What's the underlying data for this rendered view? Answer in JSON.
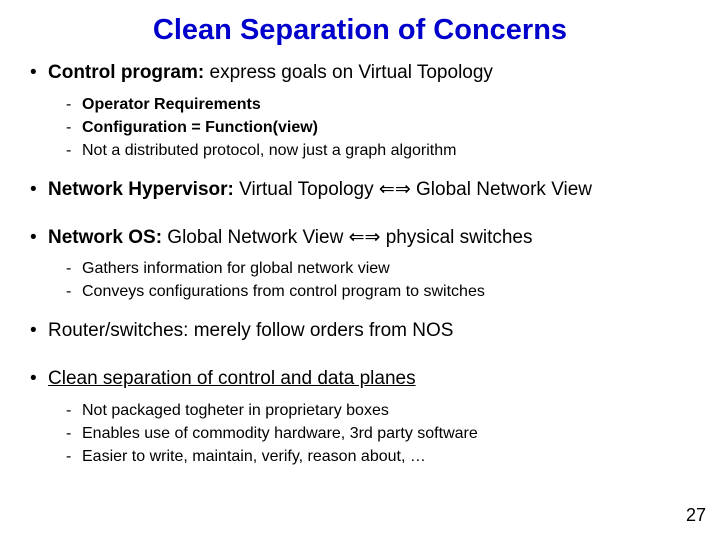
{
  "title": "Clean Separation of Concerns",
  "bullets": [
    {
      "level": 1,
      "bold_prefix": "Control program:",
      "rest": " express goals on Virtual Topology"
    },
    {
      "level": 2,
      "bold": true,
      "text": "Operator Requirements"
    },
    {
      "level": 2,
      "bold": true,
      "text": "Configuration = Function(view)"
    },
    {
      "level": 2,
      "bold": false,
      "text": "Not a distributed protocol, now just a graph algorithm"
    },
    {
      "level": 1,
      "bold_prefix": "Network Hypervisor:",
      "rest_before": " Virtual Topology ",
      "arrows": "⇔",
      "rest_after": " Global Network View"
    },
    {
      "level": 1,
      "bold_prefix": "Network OS:",
      "rest_before": " Global Network View ",
      "arrows": "⇔",
      "rest_after": " physical switches"
    },
    {
      "level": 2,
      "bold": false,
      "text": "Gathers information for global network view"
    },
    {
      "level": 2,
      "bold": false,
      "text": "Conveys configurations from control program to switches"
    },
    {
      "level": 1,
      "plain": "Router/switches: merely follow orders from NOS"
    },
    {
      "level": 1,
      "underline_text": "Clean separation of control and data planes"
    },
    {
      "level": 2,
      "bold": false,
      "text": "Not packaged togheter in proprietary boxes"
    },
    {
      "level": 2,
      "bold": false,
      "text": "Enables use of commodity hardware, 3rd party software"
    },
    {
      "level": 2,
      "bold": false,
      "text": "Easier to write, maintain, verify, reason about, …"
    }
  ],
  "arrows_glyph": "⇐⇒",
  "page_number": "27"
}
